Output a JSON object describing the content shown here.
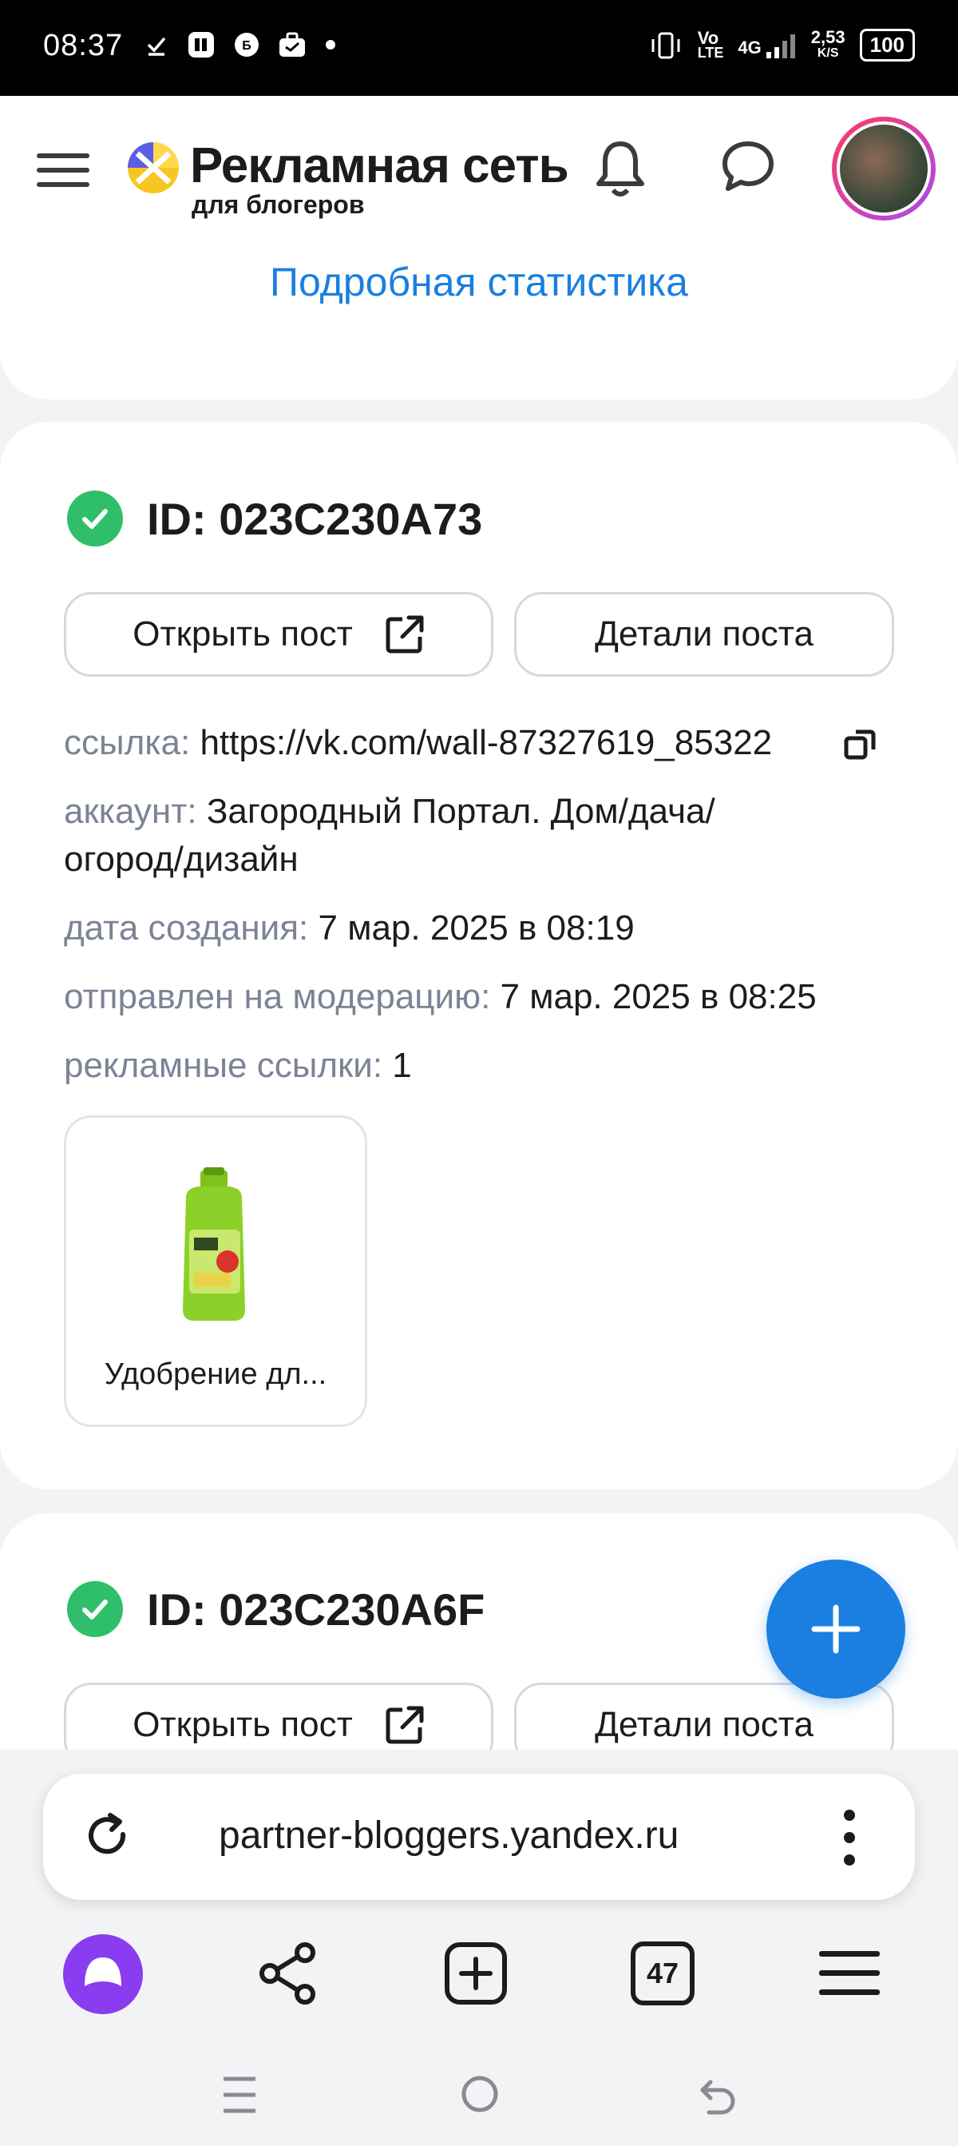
{
  "status_bar": {
    "time": "08:37",
    "network_vo": "Vo",
    "network_lte": "LTE",
    "network_4g": "4G",
    "speed_value": "2,53",
    "speed_unit": "K/S",
    "battery": "100"
  },
  "header": {
    "brand_title": "Рекламная сеть",
    "brand_subtitle": "для блогеров"
  },
  "stats_card": {
    "link_label": "Подробная статистика"
  },
  "post1": {
    "id": "ID: 023C230A73",
    "open_button": "Открыть пост",
    "details_button": "Детали поста",
    "link_key": "ссылка:",
    "link_value": "https://vk.com/wall-87327619_85322",
    "account_key": "аккаунт:",
    "account_value_1": "Загородный Портал. Дом/дача/",
    "account_value_2": "огород/дизайн",
    "created_key": "дата создания:",
    "created_value": "7 мар. 2025 в 08:19",
    "moderation_key": "отправлен на модерацию:",
    "moderation_value": "7 мар. 2025 в 08:25",
    "adlinks_key": "рекламные ссылки:",
    "adlinks_value": "1",
    "product_caption": "Удобрение дл..."
  },
  "post2": {
    "id": "ID: 023C230A6F",
    "open_button": "Открыть пост",
    "details_button": "Детали поста"
  },
  "browser": {
    "url": "partner-bloggers.yandex.ru",
    "tabs_count": "47"
  },
  "colors": {
    "accent_blue": "#1a7fe0",
    "success_green": "#2fbf6a",
    "key_gray": "#7d8396",
    "alice_purple": "#8a3cf0"
  }
}
